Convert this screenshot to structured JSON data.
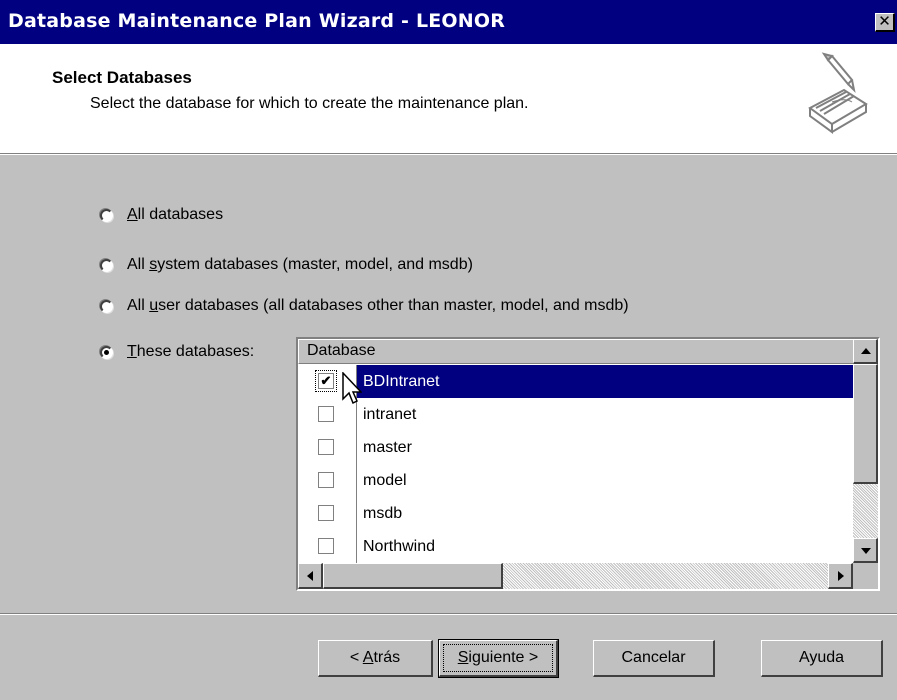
{
  "window": {
    "title": "Database Maintenance Plan Wizard - LEONOR",
    "close_glyph": "✕"
  },
  "header": {
    "title": "Select Databases",
    "subtitle": "Select the database for which to create the maintenance plan.",
    "icon": "wizard-notepad-icon"
  },
  "options": [
    {
      "key": "A",
      "rest": "ll databases",
      "selected": false
    },
    {
      "prefix": "All ",
      "key": "s",
      "rest": "ystem databases (master, model, and msdb)",
      "selected": false
    },
    {
      "prefix": "All ",
      "key": "u",
      "rest": "ser databases (all databases other than master, model, and msdb)",
      "selected": false
    },
    {
      "key": "T",
      "rest": "hese databases:",
      "selected": true
    }
  ],
  "database_list": {
    "column_header": "Database",
    "rows": [
      {
        "name": "BDIntranet",
        "checked": true,
        "selected": true
      },
      {
        "name": "intranet",
        "checked": false,
        "selected": false
      },
      {
        "name": "master",
        "checked": false,
        "selected": false
      },
      {
        "name": "model",
        "checked": false,
        "selected": false
      },
      {
        "name": "msdb",
        "checked": false,
        "selected": false
      },
      {
        "name": "Northwind",
        "checked": false,
        "selected": false
      }
    ],
    "check_glyph": "✔"
  },
  "buttons": {
    "back": {
      "prefix": "< ",
      "key": "A",
      "rest": "trás"
    },
    "next": {
      "key": "S",
      "rest": "iguiente >"
    },
    "cancel": "Cancelar",
    "help": "Ayuda"
  },
  "colors": {
    "title_bar": "#000080",
    "dialog_face": "#c0c0c0",
    "selection": "#000080"
  }
}
